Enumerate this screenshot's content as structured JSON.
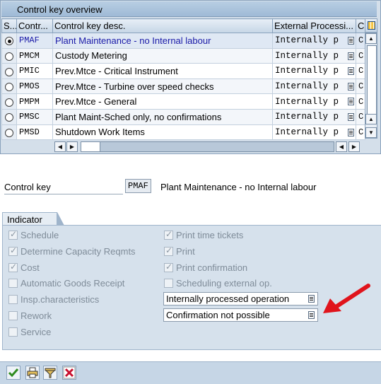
{
  "window": {
    "title": "Control key overview"
  },
  "table": {
    "headers": [
      "S...",
      "Contr...",
      "Control key desc.",
      "External Processi...",
      "C"
    ],
    "rows": [
      {
        "key": "PMAF",
        "desc": "Plant Maintenance - no Internal labour",
        "ext": "Internally p",
        "c": "C",
        "selected": true
      },
      {
        "key": "PMCM",
        "desc": "Custody Metering",
        "ext": "Internally p",
        "c": "C",
        "selected": false
      },
      {
        "key": "PMIC",
        "desc": "Prev.Mtce - Critical Instrument",
        "ext": "Internally p",
        "c": "C",
        "selected": false
      },
      {
        "key": "PMOS",
        "desc": "Prev.Mtce - Turbine over speed checks",
        "ext": "Internally p",
        "c": "C",
        "selected": false
      },
      {
        "key": "PMPM",
        "desc": "Prev.Mtce - General",
        "ext": "Internally p",
        "c": "C",
        "selected": false
      },
      {
        "key": "PMSC",
        "desc": "Plant Maint-Sched only, no confirmations",
        "ext": "Internally p",
        "c": "C",
        "selected": false
      },
      {
        "key": "PMSD",
        "desc": "Shutdown Work Items",
        "ext": "Internally p",
        "c": "C",
        "selected": false
      }
    ]
  },
  "control_key": {
    "label": "Control key",
    "value": "PMAF",
    "description": "Plant Maintenance - no Internal labour"
  },
  "indicator": {
    "title": "Indicator",
    "left": [
      {
        "label": "Schedule",
        "checked": true
      },
      {
        "label": "Determine Capacity Reqmts",
        "checked": true
      },
      {
        "label": "Cost",
        "checked": true
      },
      {
        "label": "Automatic Goods Receipt",
        "checked": false
      },
      {
        "label": "Insp.characteristics",
        "checked": false
      },
      {
        "label": "Rework",
        "checked": false
      },
      {
        "label": "Service",
        "checked": false
      }
    ],
    "right": [
      {
        "label": "Print time tickets",
        "checked": true
      },
      {
        "label": "Print",
        "checked": true
      },
      {
        "label": "Print confirmation",
        "checked": true
      },
      {
        "label": "Scheduling external op.",
        "checked": false
      }
    ],
    "external_processing": "Internally processed operation",
    "confirmation": "Confirmation not possible"
  },
  "colors": {
    "panel_bg": "#d4dfea",
    "selected_text": "#1a1aa8",
    "annotation_arrow": "#e0141c",
    "confirm_green": "#2e8b1e",
    "cancel_red": "#c8102e"
  },
  "icons": {
    "confirm": "check-icon",
    "print": "print-icon",
    "filter": "filter-icon",
    "cancel": "cancel-icon"
  }
}
